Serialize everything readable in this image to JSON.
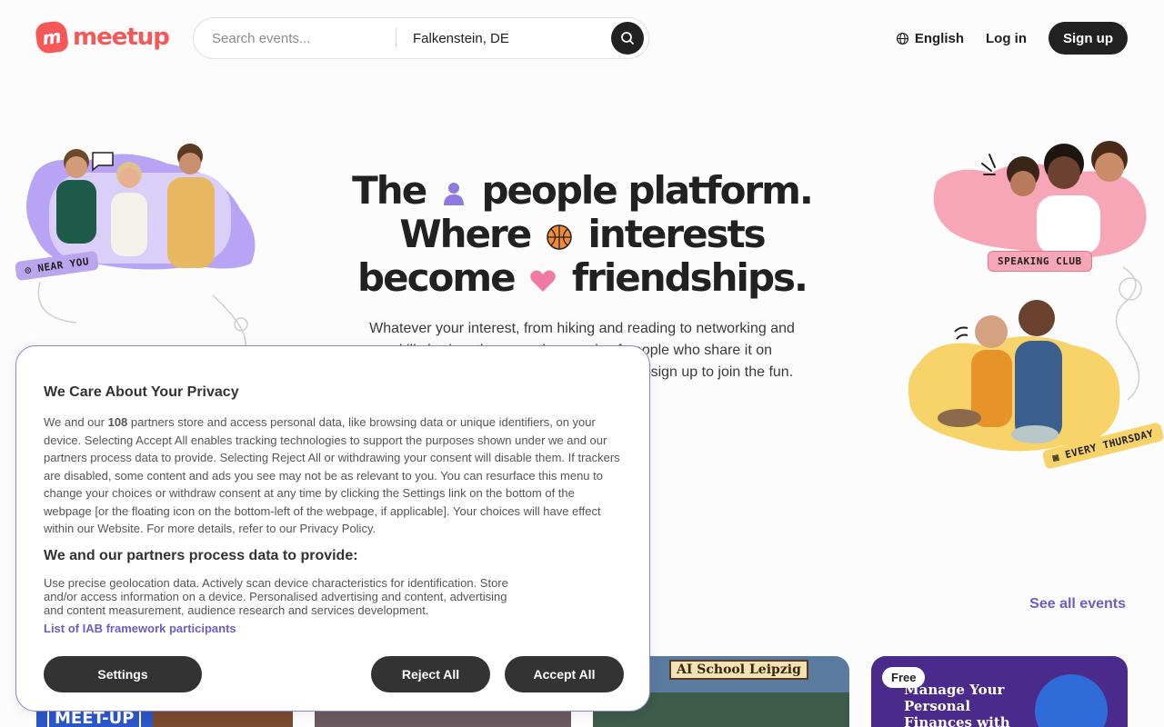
{
  "header": {
    "logo_text": "meetup",
    "search_placeholder": "Search events...",
    "location_value": "Falkenstein, DE",
    "language": "English",
    "login": "Log in",
    "signup": "Sign up"
  },
  "hero": {
    "line1_a": "The",
    "line1_b": "people platform.",
    "line2_a": "Where",
    "line2_b": "interests",
    "line3_a": "become",
    "line3_b": "friendships.",
    "subtitle": "Whatever your interest, from hiking and reading to networking and skill sharing, there are thousands of people who share it on Meetup. Events are happening every day—sign up to join the fun."
  },
  "tags": {
    "near_you": "NEAR YOU",
    "speaking_club": "SPEAKING CLUB",
    "every_thursday": "EVERY THURSDAY"
  },
  "events": {
    "see_all": "See all events",
    "card1_text": "MEET-UP",
    "card3_text": "AI School Leipzig",
    "card4_badge": "Free",
    "card4_text": "Manage Your Personal Finances with Confidence"
  },
  "privacy": {
    "title": "We Care About Your Privacy",
    "body_pre": "We and our",
    "partner_count": "108",
    "body_post": "partners store and access personal data, like browsing data or unique identifiers, on your device. Selecting Accept All enables tracking technologies to support the purposes shown under we and our partners process data to provide. Selecting Reject All or withdrawing your consent will disable them. If trackers are disabled, some content and ads you see may not be as relevant to you. You can resurface this menu to change your choices or withdraw consent at any time by clicking the Settings link on the bottom of the webpage [or the floating icon on the bottom-left of the webpage, if applicable]. Your choices will have effect within our Website. For more details, refer to our Privacy Policy.",
    "subtitle": "We and our partners process data to provide:",
    "purposes": "Use precise geolocation data. Actively scan device characteristics for identification. Store and/or access information on a device. Personalised advertising and content, advertising and content measurement, audience research and services development.",
    "link": "List of IAB framework participants",
    "settings": "Settings",
    "reject": "Reject All",
    "accept": "Accept All"
  },
  "colors": {
    "brand": "#f65858",
    "accent": "#6e5cc8",
    "dark": "#212121"
  }
}
